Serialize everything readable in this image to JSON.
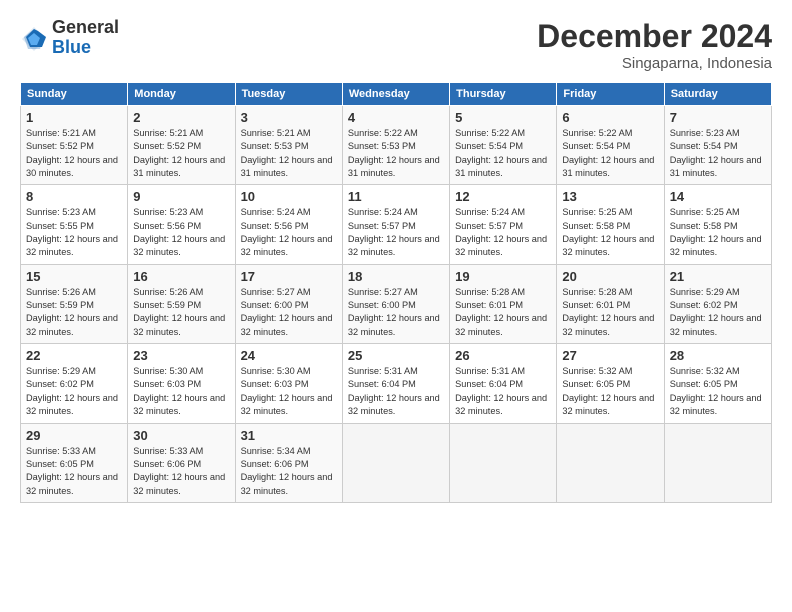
{
  "header": {
    "logo_general": "General",
    "logo_blue": "Blue",
    "month_title": "December 2024",
    "location": "Singaparna, Indonesia"
  },
  "weekdays": [
    "Sunday",
    "Monday",
    "Tuesday",
    "Wednesday",
    "Thursday",
    "Friday",
    "Saturday"
  ],
  "weeks": [
    [
      {
        "day": 1,
        "sunrise": "5:21 AM",
        "sunset": "5:52 PM",
        "daylight": "12 hours and 30 minutes."
      },
      {
        "day": 2,
        "sunrise": "5:21 AM",
        "sunset": "5:52 PM",
        "daylight": "12 hours and 31 minutes."
      },
      {
        "day": 3,
        "sunrise": "5:21 AM",
        "sunset": "5:53 PM",
        "daylight": "12 hours and 31 minutes."
      },
      {
        "day": 4,
        "sunrise": "5:22 AM",
        "sunset": "5:53 PM",
        "daylight": "12 hours and 31 minutes."
      },
      {
        "day": 5,
        "sunrise": "5:22 AM",
        "sunset": "5:54 PM",
        "daylight": "12 hours and 31 minutes."
      },
      {
        "day": 6,
        "sunrise": "5:22 AM",
        "sunset": "5:54 PM",
        "daylight": "12 hours and 31 minutes."
      },
      {
        "day": 7,
        "sunrise": "5:23 AM",
        "sunset": "5:54 PM",
        "daylight": "12 hours and 31 minutes."
      }
    ],
    [
      {
        "day": 8,
        "sunrise": "5:23 AM",
        "sunset": "5:55 PM",
        "daylight": "12 hours and 32 minutes."
      },
      {
        "day": 9,
        "sunrise": "5:23 AM",
        "sunset": "5:56 PM",
        "daylight": "12 hours and 32 minutes."
      },
      {
        "day": 10,
        "sunrise": "5:24 AM",
        "sunset": "5:56 PM",
        "daylight": "12 hours and 32 minutes."
      },
      {
        "day": 11,
        "sunrise": "5:24 AM",
        "sunset": "5:57 PM",
        "daylight": "12 hours and 32 minutes."
      },
      {
        "day": 12,
        "sunrise": "5:24 AM",
        "sunset": "5:57 PM",
        "daylight": "12 hours and 32 minutes."
      },
      {
        "day": 13,
        "sunrise": "5:25 AM",
        "sunset": "5:58 PM",
        "daylight": "12 hours and 32 minutes."
      },
      {
        "day": 14,
        "sunrise": "5:25 AM",
        "sunset": "5:58 PM",
        "daylight": "12 hours and 32 minutes."
      }
    ],
    [
      {
        "day": 15,
        "sunrise": "5:26 AM",
        "sunset": "5:59 PM",
        "daylight": "12 hours and 32 minutes."
      },
      {
        "day": 16,
        "sunrise": "5:26 AM",
        "sunset": "5:59 PM",
        "daylight": "12 hours and 32 minutes."
      },
      {
        "day": 17,
        "sunrise": "5:27 AM",
        "sunset": "6:00 PM",
        "daylight": "12 hours and 32 minutes."
      },
      {
        "day": 18,
        "sunrise": "5:27 AM",
        "sunset": "6:00 PM",
        "daylight": "12 hours and 32 minutes."
      },
      {
        "day": 19,
        "sunrise": "5:28 AM",
        "sunset": "6:01 PM",
        "daylight": "12 hours and 32 minutes."
      },
      {
        "day": 20,
        "sunrise": "5:28 AM",
        "sunset": "6:01 PM",
        "daylight": "12 hours and 32 minutes."
      },
      {
        "day": 21,
        "sunrise": "5:29 AM",
        "sunset": "6:02 PM",
        "daylight": "12 hours and 32 minutes."
      }
    ],
    [
      {
        "day": 22,
        "sunrise": "5:29 AM",
        "sunset": "6:02 PM",
        "daylight": "12 hours and 32 minutes."
      },
      {
        "day": 23,
        "sunrise": "5:30 AM",
        "sunset": "6:03 PM",
        "daylight": "12 hours and 32 minutes."
      },
      {
        "day": 24,
        "sunrise": "5:30 AM",
        "sunset": "6:03 PM",
        "daylight": "12 hours and 32 minutes."
      },
      {
        "day": 25,
        "sunrise": "5:31 AM",
        "sunset": "6:04 PM",
        "daylight": "12 hours and 32 minutes."
      },
      {
        "day": 26,
        "sunrise": "5:31 AM",
        "sunset": "6:04 PM",
        "daylight": "12 hours and 32 minutes."
      },
      {
        "day": 27,
        "sunrise": "5:32 AM",
        "sunset": "6:05 PM",
        "daylight": "12 hours and 32 minutes."
      },
      {
        "day": 28,
        "sunrise": "5:32 AM",
        "sunset": "6:05 PM",
        "daylight": "12 hours and 32 minutes."
      }
    ],
    [
      {
        "day": 29,
        "sunrise": "5:33 AM",
        "sunset": "6:05 PM",
        "daylight": "12 hours and 32 minutes."
      },
      {
        "day": 30,
        "sunrise": "5:33 AM",
        "sunset": "6:06 PM",
        "daylight": "12 hours and 32 minutes."
      },
      {
        "day": 31,
        "sunrise": "5:34 AM",
        "sunset": "6:06 PM",
        "daylight": "12 hours and 32 minutes."
      },
      null,
      null,
      null,
      null
    ]
  ]
}
